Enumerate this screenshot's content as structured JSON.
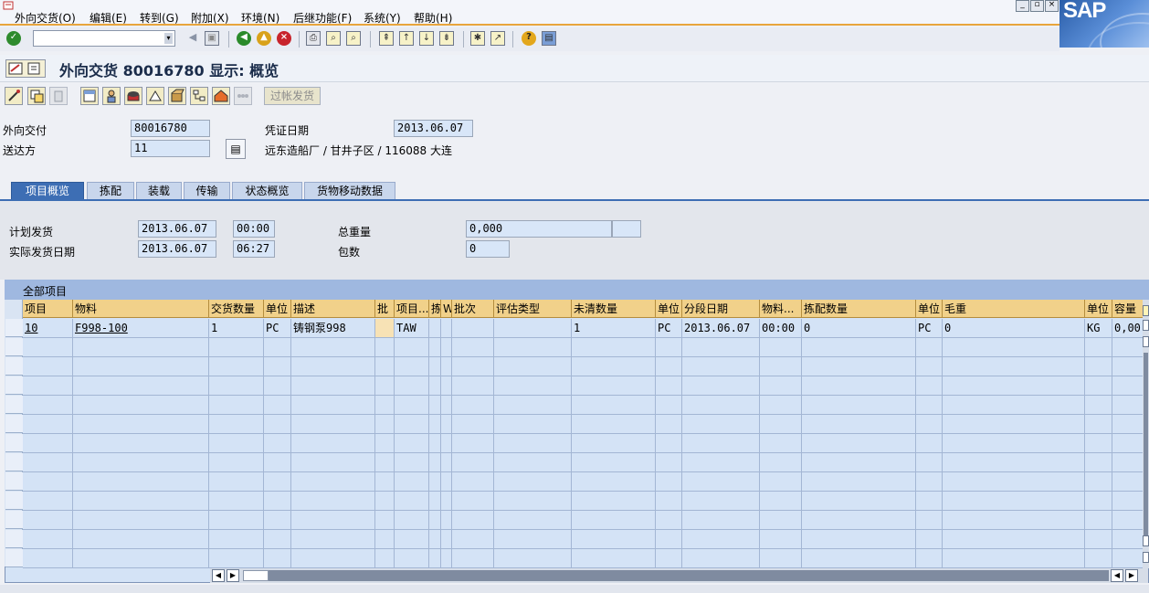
{
  "menu": {
    "items": [
      "外向交货(O)",
      "编辑(E)",
      "转到(G)",
      "附加(X)",
      "环境(N)",
      "后继功能(F)",
      "系统(Y)",
      "帮助(H)"
    ]
  },
  "brand": {
    "logo": "SAP"
  },
  "toolbar": {
    "command_value": "",
    "icons": [
      "enter-icon",
      "save-icon",
      "back-icon",
      "exit-icon",
      "cancel-icon",
      "print-icon",
      "find-icon",
      "find-next-icon",
      "first-page-icon",
      "previous-page-icon",
      "next-page-icon",
      "last-page-icon",
      "create-session-icon",
      "shortcut-icon",
      "help-icon",
      "layout-menu-icon"
    ]
  },
  "title": {
    "text": "外向交货 80016780 显示: 概览"
  },
  "app_toolbar": {
    "post_goods_issue": "过帐发货"
  },
  "header": {
    "delivery_label": "外向交付",
    "delivery_value": "80016780",
    "shipto_label": "送达方",
    "shipto_value": "11",
    "docdate_label": "凭证日期",
    "docdate_value": "2013.06.07",
    "shipto_address": "远东造船厂 / 甘井子区 / 116088 大连"
  },
  "tabs": [
    "项目概览",
    "拣配",
    "装载",
    "传输",
    "状态概览",
    "货物移动数据"
  ],
  "overview": {
    "planned_gi_label": "计划发货",
    "planned_gi_date": "2013.06.07",
    "planned_gi_time": "00:00",
    "actual_gi_label": "实际发货日期",
    "actual_gi_date": "2013.06.07",
    "actual_gi_time": "06:27",
    "total_weight_label": "总重量",
    "total_weight_value": "0,000",
    "packages_label": "包数",
    "packages_value": "0"
  },
  "table": {
    "title": "全部项目",
    "columns": [
      "项目",
      "物料",
      "交货数量",
      "单位",
      "描述",
      "批",
      "项目...",
      "拣",
      "W",
      "批次",
      "评估类型",
      "未清数量",
      "单位",
      "分段日期",
      "物料...",
      "拣配数量",
      "单位",
      "毛重",
      "单位",
      "容量"
    ],
    "rows": [
      [
        "10",
        "F998-100",
        "1",
        "PC",
        "铸钢泵998",
        "",
        "TAW",
        "",
        "",
        "",
        "",
        "1",
        "PC",
        "2013.06.07",
        "00:00",
        "0",
        "PC",
        "0",
        "KG",
        "0,00"
      ]
    ]
  },
  "colors": {
    "tab_active": "#3d6eb4",
    "column_header": "#f1d18a",
    "grid_background": "#d4e3f6",
    "menu_underline": "#e8a53c"
  }
}
